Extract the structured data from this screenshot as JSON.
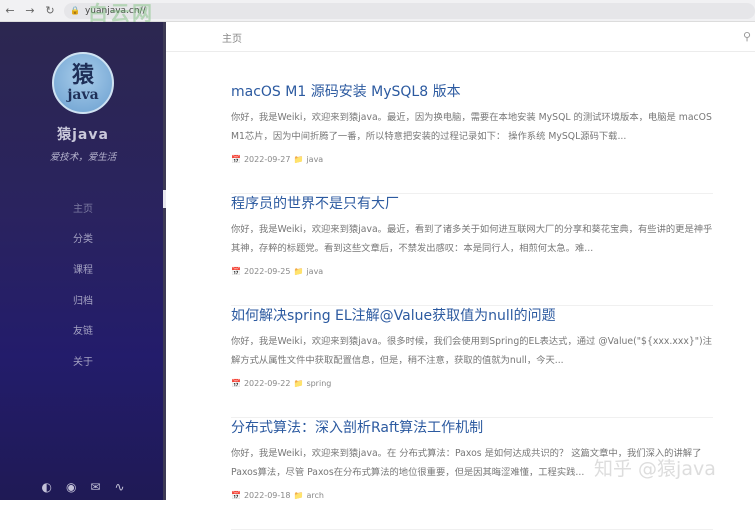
{
  "browser": {
    "url": "yuanjava.cn//",
    "watermark": "白云网"
  },
  "sidebar": {
    "avatar": {
      "glyph": "猿",
      "word": "java"
    },
    "title": "猿java",
    "subtitle": "爱技术，爱生活",
    "nav": [
      {
        "label": "主页"
      },
      {
        "label": "分类"
      },
      {
        "label": "课程"
      },
      {
        "label": "归档"
      },
      {
        "label": "友链"
      },
      {
        "label": "关于"
      }
    ],
    "bottom_icons": [
      "theme-toggle-icon",
      "github-icon",
      "mail-icon",
      "rss-icon"
    ]
  },
  "topbar": {
    "home_label": "主页"
  },
  "posts": [
    {
      "title": "macOS M1 源码安装 MySQL8 版本",
      "excerpt": "你好，我是Weiki，欢迎来到猿java。最近，因为换电脑，需要在本地安装 MySQL 的测试环境版本，电脑是 macOS M1芯片，因为中间折腾了一番，所以特意把安装的过程记录如下： 操作系统 MySQL源码下载...",
      "date": "2022-09-27",
      "category": "java"
    },
    {
      "title": "程序员的世界不是只有大厂",
      "excerpt": "你好，我是Weiki，欢迎来到猿java。最近，看到了诸多关于如何进互联网大厂的分享和葵花宝典，有些讲的更是神乎其神，存粹的标题党。看到这些文章后，不禁发出感叹：本是同行人，相煎何太急。难...",
      "date": "2022-09-25",
      "category": "java"
    },
    {
      "title": "如何解决spring EL注解@Value获取值为null的问题",
      "excerpt": "你好，我是Weiki，欢迎来到猿java。很多时候，我们会使用到Spring的EL表达式，通过 @Value(\"${xxx.xxx}\")注解方式从属性文件中获取配置信息，但是，稍不注意，获取的值就为null，今天...",
      "date": "2022-09-22",
      "category": "spring"
    },
    {
      "title": "分布式算法：深入剖析Raft算法工作机制",
      "excerpt": "你好，我是Weiki，欢迎来到猿java。在 分布式算法：Paxos 是如何达成共识的？ 这篇文章中，我们深入的讲解了 Paxos算法，尽管 Paxos在分布式算法的地位很重要，但是因其晦涩难懂，工程实践...",
      "date": "2022-09-18",
      "category": "arch"
    }
  ],
  "watermark_bottom": "知乎 @猿java"
}
